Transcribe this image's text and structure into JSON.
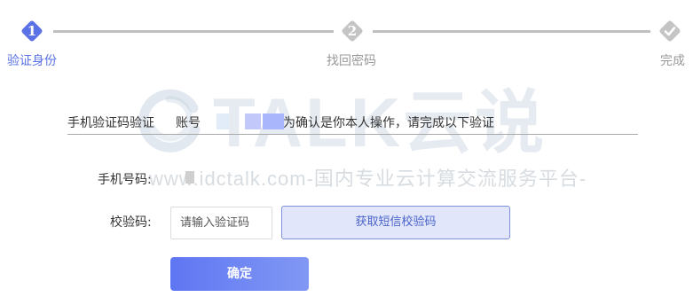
{
  "stepper": {
    "steps": [
      {
        "number": "1",
        "label": "验证身份",
        "state": "active"
      },
      {
        "number": "2",
        "label": "找回密码",
        "state": "pending"
      },
      {
        "number": "",
        "label": "完成",
        "state": "pending",
        "icon": "check-icon"
      }
    ],
    "active_color": "#5a72e6",
    "pending_color": "#bfbfbf"
  },
  "watermark": {
    "brand": "TALK云说",
    "url": "www.idctalk.com-国内专业云计算交流服务平台-"
  },
  "info": {
    "title": "手机验证码验证",
    "account_label": "账号",
    "description": "为确认是你本人操作，请完成以下验证"
  },
  "form": {
    "phone_label": "手机号码:",
    "code_label": "校验码:",
    "code_placeholder": "请输入验证码",
    "sms_button": "获取短信校验码",
    "confirm_button": "确定"
  }
}
